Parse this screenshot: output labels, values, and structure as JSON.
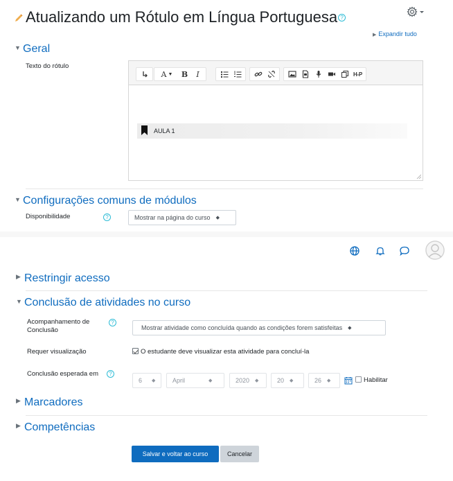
{
  "page": {
    "title": "Atualizando um Rótulo em Língua Portuguesa",
    "help_glyph": "?",
    "expand_all": "Expandir tudo"
  },
  "sections": {
    "geral": "Geral",
    "config": "Configurações comuns de módulos",
    "restringir": "Restringir acesso",
    "conclusao": "Conclusão de atividades no curso",
    "marcadores": "Marcadores",
    "competencias": "Competências"
  },
  "geral": {
    "label": "Texto do rótulo",
    "editor_content": "AULA 1",
    "toolbar": {
      "text_style": "A",
      "bold": "B",
      "italic": "I",
      "hp": "H-P"
    }
  },
  "config": {
    "disponibilidade_label": "Disponibilidade",
    "disponibilidade_value": "Mostrar na página do curso"
  },
  "conclusao": {
    "acompanhamento_label_1": "Acompanhamento de",
    "acompanhamento_label_2": "Conclusão",
    "acompanhamento_value": "Mostrar atividade como concluída quando as condições forem satisfeitas",
    "requer_label": "Requer visualização",
    "requer_text": "O estudante deve visualizar esta atividade para concluí-la",
    "esperada_label": "Conclusão esperada em",
    "day": "6",
    "month": "April",
    "year": "2020",
    "hour": "20",
    "minute": "26",
    "habilitar": "Habilitar"
  },
  "buttons": {
    "save": "Salvar e voltar ao curso",
    "cancel": "Cancelar"
  },
  "colors": {
    "link": "#0f6cbf",
    "primary": "#0f6cbf",
    "help": "#2dbcd6",
    "pencil": "#f0ad4e"
  },
  "icons": [
    "pencil-icon",
    "help-icon",
    "gear-icon",
    "bookmark-icon",
    "globe-icon",
    "bell-icon",
    "chat-icon",
    "avatar",
    "calendar-icon"
  ]
}
